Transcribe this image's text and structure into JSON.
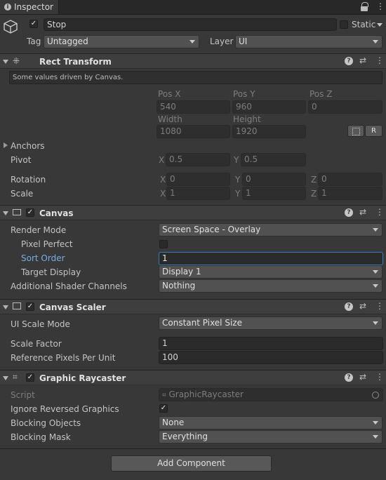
{
  "tab": {
    "title": "Inspector"
  },
  "object": {
    "name": "Stop",
    "static_label": "Static",
    "tag_label": "Tag",
    "tag_value": "Untagged",
    "layer_label": "Layer",
    "layer_value": "UI"
  },
  "rect_transform": {
    "title": "Rect Transform",
    "info": "Some values driven by Canvas.",
    "pos_x_label": "Pos X",
    "pos_y_label": "Pos Y",
    "pos_z_label": "Pos Z",
    "pos_x": "540",
    "pos_y": "960",
    "pos_z": "0",
    "width_label": "Width",
    "height_label": "Height",
    "width": "1080",
    "height": "1920",
    "r_button": "R",
    "anchors_label": "Anchors",
    "pivot_label": "Pivot",
    "pivot_x": "0.5",
    "pivot_y": "0.5",
    "rotation_label": "Rotation",
    "rot_x": "0",
    "rot_y": "0",
    "rot_z": "0",
    "scale_label": "Scale",
    "scale_x": "1",
    "scale_y": "1",
    "scale_z": "1",
    "x": "X",
    "y": "Y",
    "z": "Z"
  },
  "canvas": {
    "title": "Canvas",
    "render_mode_label": "Render Mode",
    "render_mode": "Screen Space - Overlay",
    "pixel_perfect_label": "Pixel Perfect",
    "sort_order_label": "Sort Order",
    "sort_order": "1",
    "target_display_label": "Target Display",
    "target_display": "Display 1",
    "shader_channels_label": "Additional Shader Channels",
    "shader_channels": "Nothing"
  },
  "canvas_scaler": {
    "title": "Canvas Scaler",
    "ui_scale_mode_label": "UI Scale Mode",
    "ui_scale_mode": "Constant Pixel Size",
    "scale_factor_label": "Scale Factor",
    "scale_factor": "1",
    "ref_ppu_label": "Reference Pixels Per Unit",
    "ref_ppu": "100"
  },
  "raycaster": {
    "title": "Graphic Raycaster",
    "script_label": "Script",
    "script": "GraphicRaycaster",
    "ignore_reversed_label": "Ignore Reversed Graphics",
    "blocking_objects_label": "Blocking Objects",
    "blocking_objects": "None",
    "blocking_mask_label": "Blocking Mask",
    "blocking_mask": "Everything"
  },
  "add_component": "Add Component",
  "colors": {
    "background": "#383838",
    "header": "#3e3e3e",
    "field": "#2a2a2a",
    "focus": "#3a79bb",
    "active_label": "#7babe4"
  }
}
